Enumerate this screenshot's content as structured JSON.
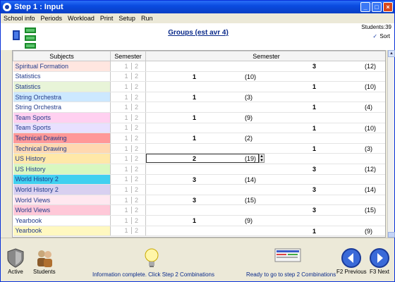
{
  "window": {
    "title": "Step 1 : Input",
    "minimize": "_",
    "maximize": "□",
    "close": "×"
  },
  "menu": [
    "School info",
    "Periods",
    "Workload",
    "Print",
    "Setup",
    "Run"
  ],
  "header": {
    "groups_title": "Groups (est avr 4)",
    "students_count": "Students:39",
    "sort_label": "Sort",
    "sort_checked": true
  },
  "table": {
    "columns": {
      "subjects": "Subjects",
      "semester_small": "Semester",
      "semester": "Semester"
    },
    "rows": [
      {
        "subject": "Spiritual Formation",
        "color": "#ffe6e0",
        "s1": "1",
        "s2": "2",
        "sem": "3",
        "count": "(12)",
        "col": 2
      },
      {
        "subject": "Statistics",
        "color": "#ffffff",
        "s1": "1",
        "s2": "2",
        "sem": "1",
        "count": "(10)",
        "col": 1
      },
      {
        "subject": "Statistics",
        "color": "#e8f4d8",
        "s1": "1",
        "s2": "2",
        "sem": "1",
        "count": "(10)",
        "col": 2
      },
      {
        "subject": "String Orchestra",
        "color": "#cce8ff",
        "s1": "1",
        "s2": "2",
        "sem": "1",
        "count": "(3)",
        "col": 1
      },
      {
        "subject": "String Orchestra",
        "color": "#ffffff",
        "s1": "1",
        "s2": "2",
        "sem": "1",
        "count": "(4)",
        "col": 2
      },
      {
        "subject": "Team Sports",
        "color": "#ffd0f0",
        "s1": "1",
        "s2": "2",
        "sem": "1",
        "count": "(9)",
        "col": 1
      },
      {
        "subject": "Team Sports",
        "color": "#e8e0ff",
        "s1": "1",
        "s2": "2",
        "sem": "1",
        "count": "(10)",
        "col": 2
      },
      {
        "subject": "Technical Drawing",
        "color": "#ff9898",
        "s1": "1",
        "s2": "2",
        "sem": "1",
        "count": "(2)",
        "col": 1
      },
      {
        "subject": "Technical Drawing",
        "color": "#ffd8b0",
        "s1": "1",
        "s2": "2",
        "sem": "1",
        "count": "(3)",
        "col": 2
      },
      {
        "subject": "US History",
        "color": "#ffe8a8",
        "s1": "1",
        "s2": "2",
        "sem": "2",
        "count": "(19)",
        "col": 1,
        "editing": true
      },
      {
        "subject": "US History",
        "color": "#d8f8c0",
        "s1": "1",
        "s2": "2",
        "sem": "3",
        "count": "(12)",
        "col": 2
      },
      {
        "subject": "World History 2",
        "color": "#40d0f0",
        "s1": "1",
        "s2": "2",
        "sem": "3",
        "count": "(14)",
        "col": 1
      },
      {
        "subject": "World History 2",
        "color": "#d8d0f0",
        "s1": "1",
        "s2": "2",
        "sem": "3",
        "count": "(14)",
        "col": 2
      },
      {
        "subject": "World Views",
        "color": "#ffe8f0",
        "s1": "1",
        "s2": "2",
        "sem": "3",
        "count": "(15)",
        "col": 1
      },
      {
        "subject": "World Views",
        "color": "#ffc8d8",
        "s1": "1",
        "s2": "2",
        "sem": "3",
        "count": "(15)",
        "col": 2
      },
      {
        "subject": "Yearbook",
        "color": "#ffffff",
        "s1": "1",
        "s2": "2",
        "sem": "1",
        "count": "(9)",
        "col": 1
      },
      {
        "subject": "Yearbook",
        "color": "#fff8c0",
        "s1": "1",
        "s2": "2",
        "sem": "1",
        "count": "(9)",
        "col": 2
      }
    ]
  },
  "footer": {
    "active": "Active",
    "students": "Students",
    "info": "Information complete. Click Step 2 Combinations",
    "ready": "Ready to go to step 2 Combinations",
    "previous": "F2 Previous",
    "next": "F3 Next"
  },
  "spin_up": "▲",
  "spin_down": "▼",
  "scroll_up": "▲",
  "scroll_down": "▼"
}
